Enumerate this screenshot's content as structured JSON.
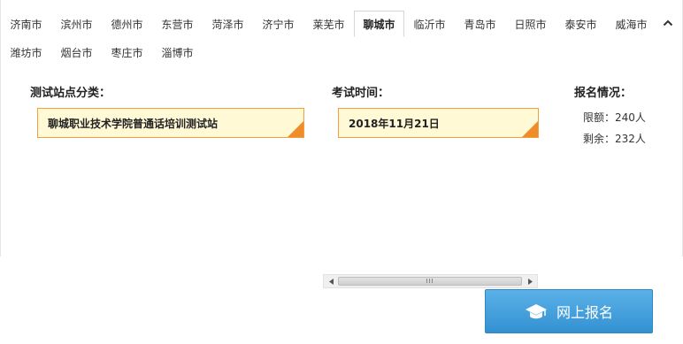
{
  "city_tabs": {
    "row1": [
      "济南市",
      "滨州市",
      "德州市",
      "东营市",
      "菏泽市",
      "济宁市",
      "莱芜市",
      "聊城市",
      "临沂市",
      "青岛市",
      "日照市",
      "泰安市",
      "威海市"
    ],
    "row2": [
      "潍坊市",
      "烟台市",
      "枣庄市",
      "淄博市"
    ],
    "active": "聊城市",
    "collapse_icon": "chevron-up-icon"
  },
  "form": {
    "site_label": "测试站点分类：",
    "site_value": "聊城职业技术学院普通话培训测试站",
    "time_label": "考试时间：",
    "time_value": "2018年11月21日",
    "status_label": "报名情况：",
    "quota_text": "限额：240人",
    "remaining_text": "剩余：232人"
  },
  "scrollbar": {
    "grip": "III"
  },
  "submit": {
    "label": "网上报名",
    "icon": "graduation-cap-icon"
  },
  "colors": {
    "select_bg": "#fff9d6",
    "select_border": "#f0a040",
    "corner": "#ef8d2b",
    "button": "#3391d1"
  }
}
